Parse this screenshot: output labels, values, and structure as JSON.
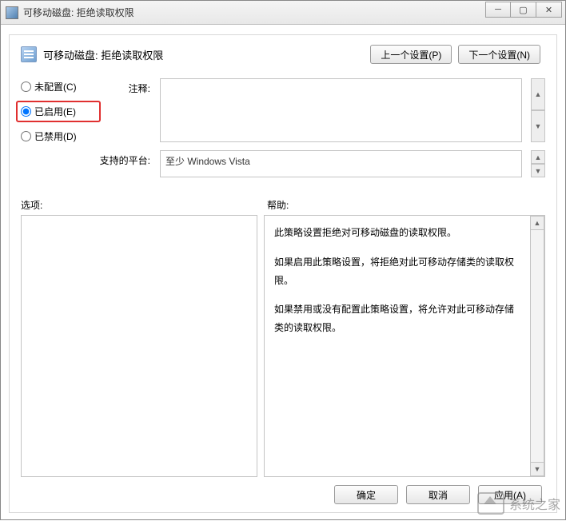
{
  "window": {
    "title": "可移动磁盘: 拒绝读取权限"
  },
  "header": {
    "title": "可移动磁盘: 拒绝读取权限",
    "prev_btn": "上一个设置(P)",
    "next_btn": "下一个设置(N)"
  },
  "radios": {
    "not_configured": "未配置(C)",
    "enabled": "已启用(E)",
    "disabled": "已禁用(D)",
    "selected": "enabled"
  },
  "labels": {
    "comment": "注释:",
    "platform": "支持的平台:",
    "options": "选项:",
    "help": "帮助:"
  },
  "comment_value": "",
  "platform_value": "至少 Windows Vista",
  "help_paragraphs": [
    "此策略设置拒绝对可移动磁盘的读取权限。",
    "如果启用此策略设置，将拒绝对此可移动存储类的读取权限。",
    "如果禁用或没有配置此策略设置，将允许对此可移动存储类的读取权限。"
  ],
  "buttons": {
    "ok": "确定",
    "cancel": "取消",
    "apply": "应用(A)"
  },
  "watermark_text": "系统之家"
}
